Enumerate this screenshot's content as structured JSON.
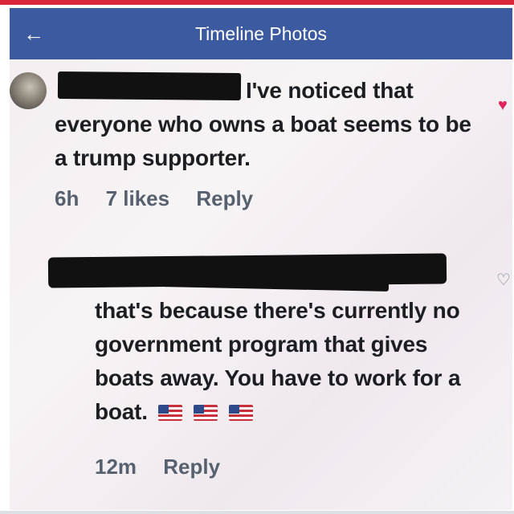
{
  "nav": {
    "back_icon": "arrow-left-icon",
    "title": "Timeline Photos"
  },
  "comments": [
    {
      "author": "",
      "text": "I've noticed that everyone who owns a boat seems to be a trump supporter.",
      "time": "6h",
      "likes": "7 likes",
      "reply_label": "Reply",
      "reaction_icon": "heart-filled-icon",
      "reaction_color": "#e0245e"
    },
    {
      "author": "",
      "text": "that's because there's currently no government program that gives boats away. You have to work for a boat.",
      "emoji": "flag-us-icon",
      "emoji_count": 3,
      "time": "12m",
      "reply_label": "Reply",
      "reaction_icon": "heart-outline-icon"
    }
  ],
  "colors": {
    "navbar": "#3b5a9f",
    "accent_red": "#d8273a"
  }
}
